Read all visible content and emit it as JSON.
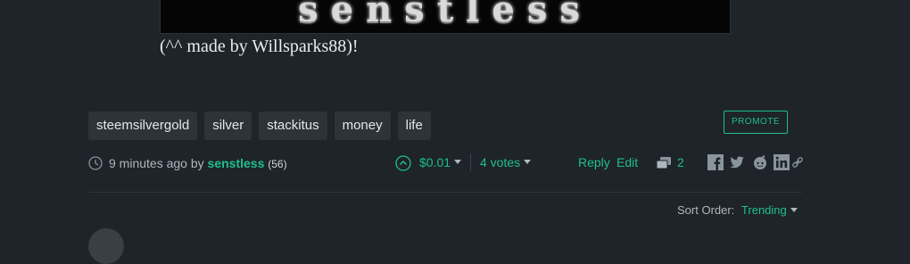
{
  "post": {
    "banner_text": "senstless",
    "credit": "(^^ made by Willsparks88)!"
  },
  "tags": [
    "steemsilvergold",
    "silver",
    "stackitus",
    "money",
    "life"
  ],
  "promote_label": "PROMOTE",
  "meta": {
    "time": "9 minutes ago",
    "by": "by",
    "author": "senstless",
    "reputation": "(56)",
    "payout": "$0.01",
    "votes": "4 votes",
    "reply": "Reply",
    "edit": "Edit",
    "comments": "2"
  },
  "share_icons": [
    "facebook-icon",
    "twitter-icon",
    "reddit-icon",
    "linkedin-icon",
    "link-icon"
  ],
  "sort": {
    "label": "Sort Order:",
    "value": "Trending"
  },
  "colors": {
    "background": "#1e2429",
    "accent": "#1fbf8f",
    "tag_bg": "#2c3339"
  }
}
